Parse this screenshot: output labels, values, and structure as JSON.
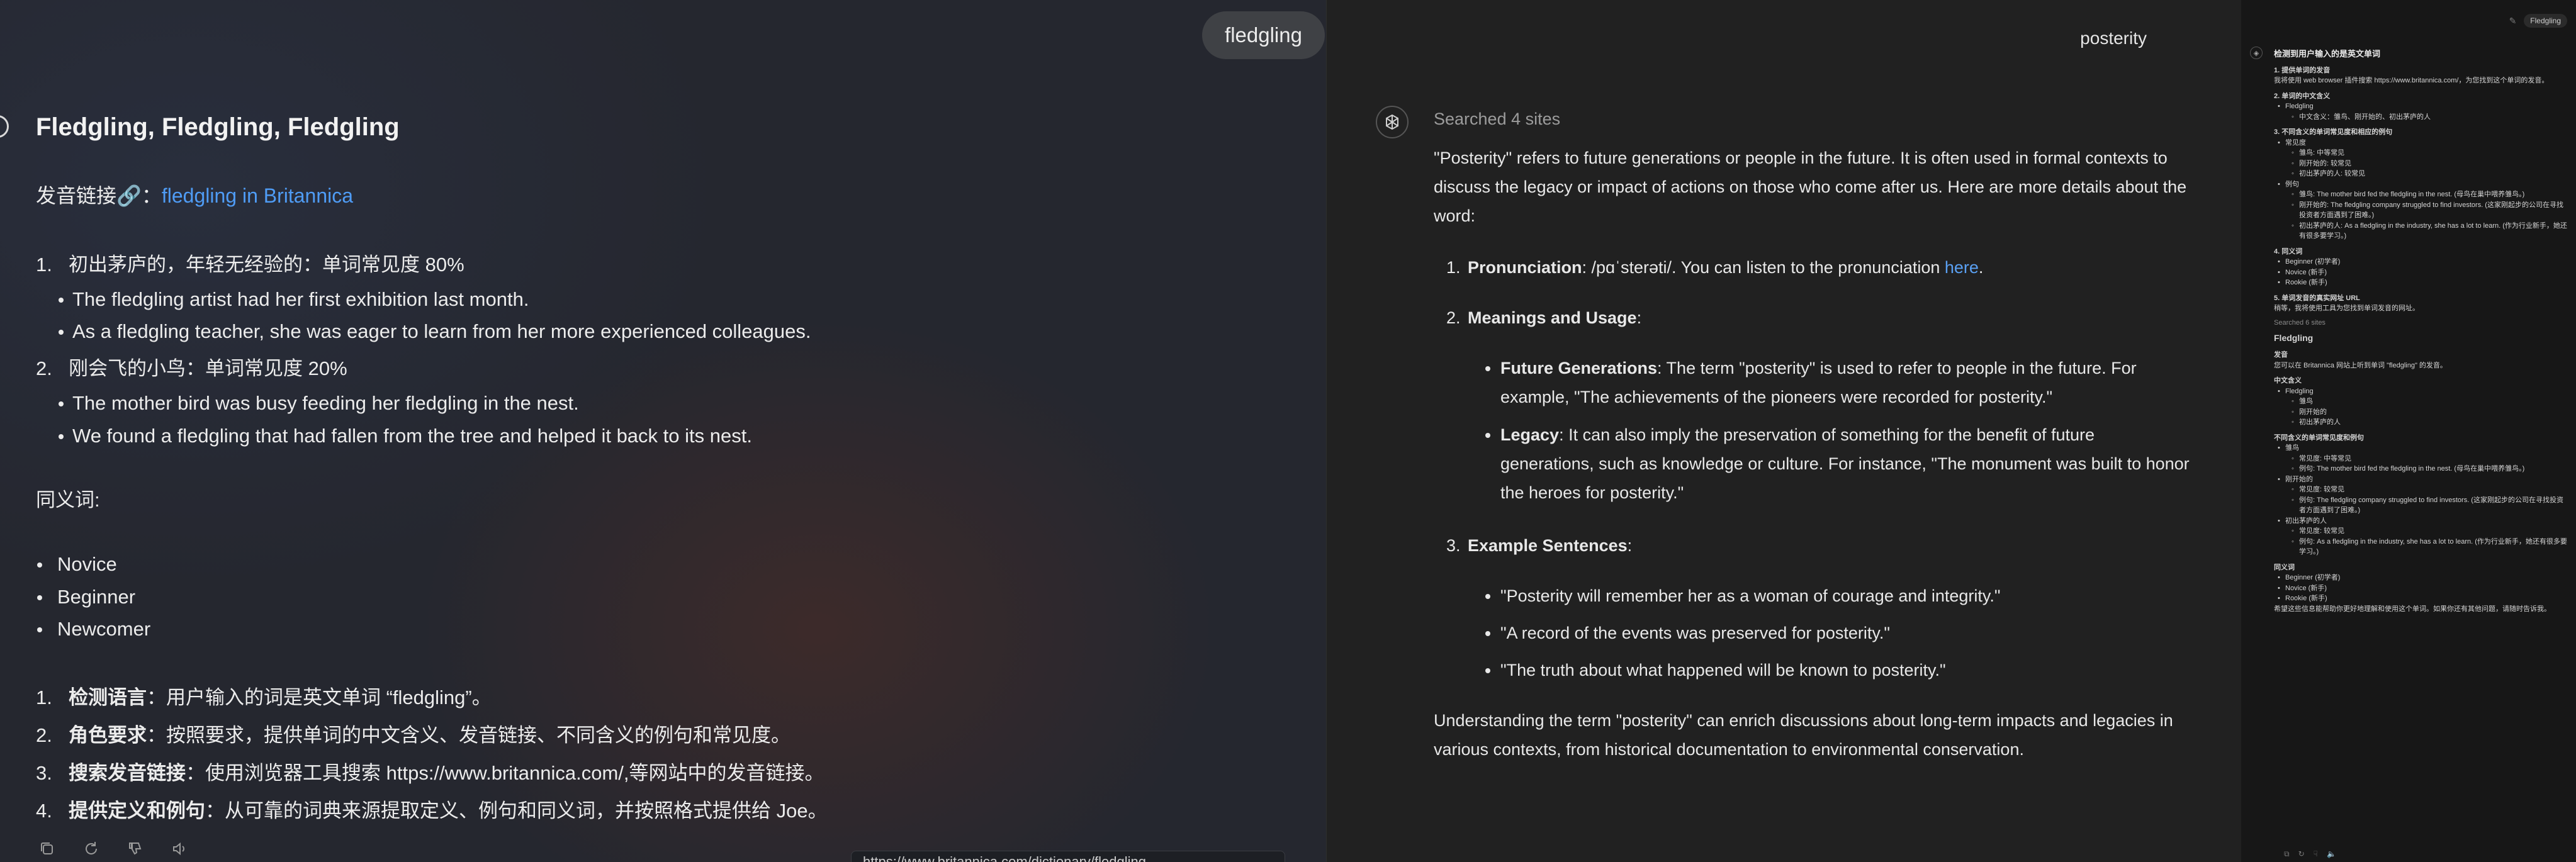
{
  "panel1": {
    "user_message": "fledgling",
    "title": "Fledgling, Fledgling, Fledgling",
    "pron_label": "发音链接🔗：",
    "pron_link": "fledgling in Britannica",
    "senses": [
      {
        "num": "1.",
        "text": "初出茅庐的，年轻无经验的：单词常见度 80%",
        "examples": [
          "The fledgling artist had her first exhibition last month.",
          "As a fledgling teacher, she was eager to learn from her more experienced colleagues."
        ]
      },
      {
        "num": "2.",
        "text": "刚会飞的小鸟：单词常见度 20%",
        "examples": [
          "The mother bird was busy feeding her fledgling in the nest.",
          "We found a fledgling that had fallen from the tree and helped it back to its nest."
        ]
      }
    ],
    "synonyms_heading": "同义词:",
    "synonyms": [
      "Novice",
      "Beginner",
      "Newcomer"
    ],
    "steps": [
      {
        "num": "1.",
        "bold": "检测语言",
        "text": "：用户输入的词是英文单词 “fledgling”。"
      },
      {
        "num": "2.",
        "bold": "角色要求",
        "text": "：按照要求，提供单词的中文含义、发音链接、不同含义的例句和常见度。"
      },
      {
        "num": "3.",
        "bold": "搜索发音链接",
        "text": "：使用浏览器工具搜索 https://www.britannica.com/,等网站中的发音链接。"
      },
      {
        "num": "4.",
        "bold": "提供定义和例句",
        "text": "：从可靠的词典来源提取定义、例句和同义词，并按照格式提供给 Joe。"
      }
    ],
    "action_icons": [
      "copy-icon",
      "regenerate-icon",
      "thumbs-down-icon",
      "speaker-icon"
    ],
    "url_bar": "https://www.britannica.com/dictionary/fledgling"
  },
  "panel2": {
    "user_message": "posterity",
    "searched": "Searched 4 sites",
    "intro": "\"Posterity\" refers to future generations or people in the future. It is often used in formal contexts to discuss the legacy or impact of actions on those who come after us. Here are more details about the word:",
    "item1_bold": "Pronunciation",
    "item1_text": ": /pɑˈsterəti/. You can listen to the pronunciation ",
    "item1_link": "here",
    "item1_end": ".",
    "item2_bold": "Meanings and Usage",
    "item2_end": ":",
    "meanings": [
      {
        "bold": "Future Generations",
        "text": ": The term \"posterity\" is used to refer to people in the future. For example, \"The achievements of the pioneers were recorded for posterity.\""
      },
      {
        "bold": "Legacy",
        "text": ": It can also imply the preservation of something for the benefit of future generations, such as knowledge or culture. For instance, \"The monument was built to honor the heroes for posterity.\""
      }
    ],
    "item3_bold": "Example Sentences",
    "item3_end": ":",
    "examples": [
      "\"Posterity will remember her as a woman of courage and integrity.\"",
      "\"A record of the events was preserved for posterity.\"",
      "\"The truth about what happened will be known to posterity.\""
    ],
    "outro": "Understanding the term \"posterity\" can enrich discussions about long-term impacts and legacies in various contexts, from historical documentation to environmental conservation."
  },
  "panel3": {
    "tag": "Fledgling",
    "heading": "检测到用户输入的是英文单词",
    "lines": [
      {
        "cls": "sh",
        "text": "1. 提供单词的发音"
      },
      {
        "cls": "t",
        "text": "我将使用 web browser 插件搜索 https://www.britannica.com/，为您找到这个单词的发音。"
      },
      {
        "cls": "sh",
        "text": "2. 单词的中文含义"
      },
      {
        "cls": "l1",
        "text": "Fledgling"
      },
      {
        "cls": "l2",
        "text": "中文含义：雏鸟、刚开始的、初出茅庐的人"
      },
      {
        "cls": "sh",
        "text": "3. 不同含义的单词常见度和相应的例句"
      },
      {
        "cls": "l1",
        "text": "常见度"
      },
      {
        "cls": "l2",
        "text": "雏鸟: 中等常见"
      },
      {
        "cls": "l2",
        "text": "刚开始的: 较常见"
      },
      {
        "cls": "l2",
        "text": "初出茅庐的人: 较常见"
      },
      {
        "cls": "l1",
        "text": "例句"
      },
      {
        "cls": "l2",
        "text": "雏鸟: The mother bird fed the fledgling in the nest. (母鸟在巢中喂养雏鸟。)"
      },
      {
        "cls": "l2",
        "text": "刚开始的: The fledgling company struggled to find investors. (这家刚起步的公司在寻找投资者方面遇到了困难。)"
      },
      {
        "cls": "l2",
        "text": "初出茅庐的人: As a fledgling in the industry, she has a lot to learn. (作为行业新手，她还有很多要学习。)"
      },
      {
        "cls": "sh",
        "text": "4. 同义词"
      },
      {
        "cls": "l1",
        "text": "Beginner (初学者)"
      },
      {
        "cls": "l1",
        "text": "Novice (新手)"
      },
      {
        "cls": "l1",
        "text": "Rookie (新手)"
      },
      {
        "cls": "sh",
        "text": "5. 单词发音的真实网址 URL"
      },
      {
        "cls": "t",
        "text": "稍等，我将使用工具为您找到单词发音的网址。"
      },
      {
        "cls": "muted",
        "text": "Searched 6 sites"
      },
      {
        "cls": "big",
        "text": "Fledgling"
      },
      {
        "cls": "sh",
        "text": "发音"
      },
      {
        "cls": "t",
        "text": "您可以在 Britannica 网站上听到单词 \"fledgling\" 的发音。"
      },
      {
        "cls": "sh",
        "text": "中文含义"
      },
      {
        "cls": "l1",
        "text": "Fledgling"
      },
      {
        "cls": "l2",
        "text": "雏鸟"
      },
      {
        "cls": "l2",
        "text": "刚开始的"
      },
      {
        "cls": "l2",
        "text": "初出茅庐的人"
      },
      {
        "cls": "sh",
        "text": "不同含义的单词常见度和例句"
      },
      {
        "cls": "l1",
        "text": "雏鸟"
      },
      {
        "cls": "l2",
        "text": "常见度: 中等常见"
      },
      {
        "cls": "l2",
        "text": "例句: The mother bird fed the fledgling in the nest. (母鸟在巢中喂养雏鸟。)"
      },
      {
        "cls": "l1",
        "text": "刚开始的"
      },
      {
        "cls": "l2",
        "text": "常见度: 较常见"
      },
      {
        "cls": "l2",
        "text": "例句: The fledgling company struggled to find investors. (这家刚起步的公司在寻找投资者方面遇到了困难。)"
      },
      {
        "cls": "l1",
        "text": "初出茅庐的人"
      },
      {
        "cls": "l2",
        "text": "常见度: 较常见"
      },
      {
        "cls": "l2",
        "text": "例句: As a fledgling in the industry, she has a lot to learn. (作为行业新手，她还有很多要学习。)"
      },
      {
        "cls": "sh",
        "text": "同义词"
      },
      {
        "cls": "l1",
        "text": "Beginner (初学者)"
      },
      {
        "cls": "l1",
        "text": "Novice (新手)"
      },
      {
        "cls": "l1",
        "text": "Rookie (新手)"
      },
      {
        "cls": "t",
        "text": "希望这些信息能帮助你更好地理解和使用这个单词。如果你还有其他问题，请随时告诉我。"
      }
    ]
  }
}
